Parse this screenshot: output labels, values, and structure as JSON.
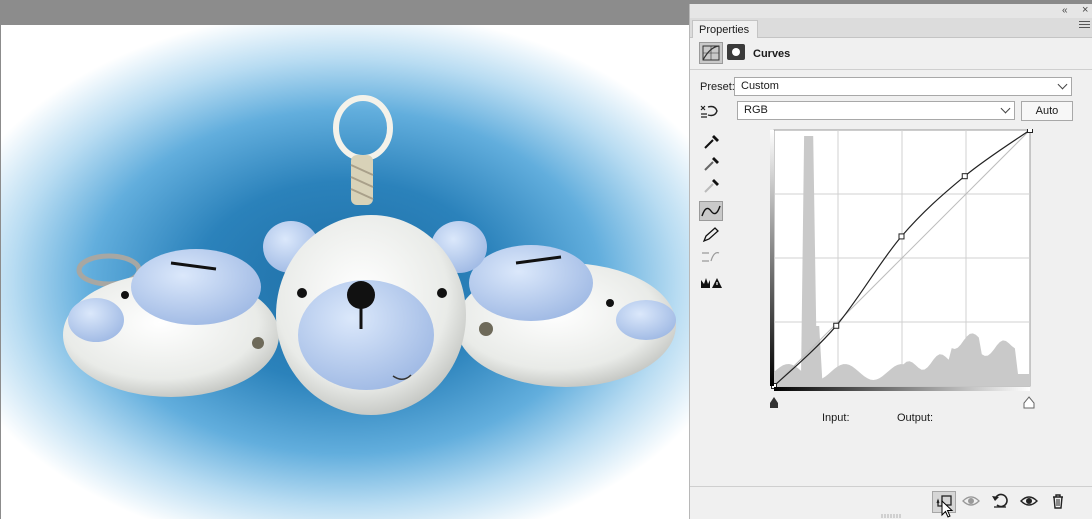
{
  "panel": {
    "tab_label": "Properties",
    "title": "Curves",
    "preset_label": "Preset:",
    "preset_value": "Custom",
    "channel_value": "RGB",
    "auto_label": "Auto",
    "input_label": "Input:",
    "output_label": "Output:"
  },
  "icons": {
    "collapse": "«",
    "close": "×"
  },
  "colors": {
    "panel_bg": "#f0f0f0",
    "canvas_bg": "#8c8c8c",
    "vignette_blue": "#2b82bb"
  },
  "curve_points": [
    {
      "input": 0,
      "output": 0
    },
    {
      "input": 62,
      "output": 60
    },
    {
      "input": 127,
      "output": 149
    },
    {
      "input": 190,
      "output": 209
    },
    {
      "input": 255,
      "output": 255
    }
  ]
}
